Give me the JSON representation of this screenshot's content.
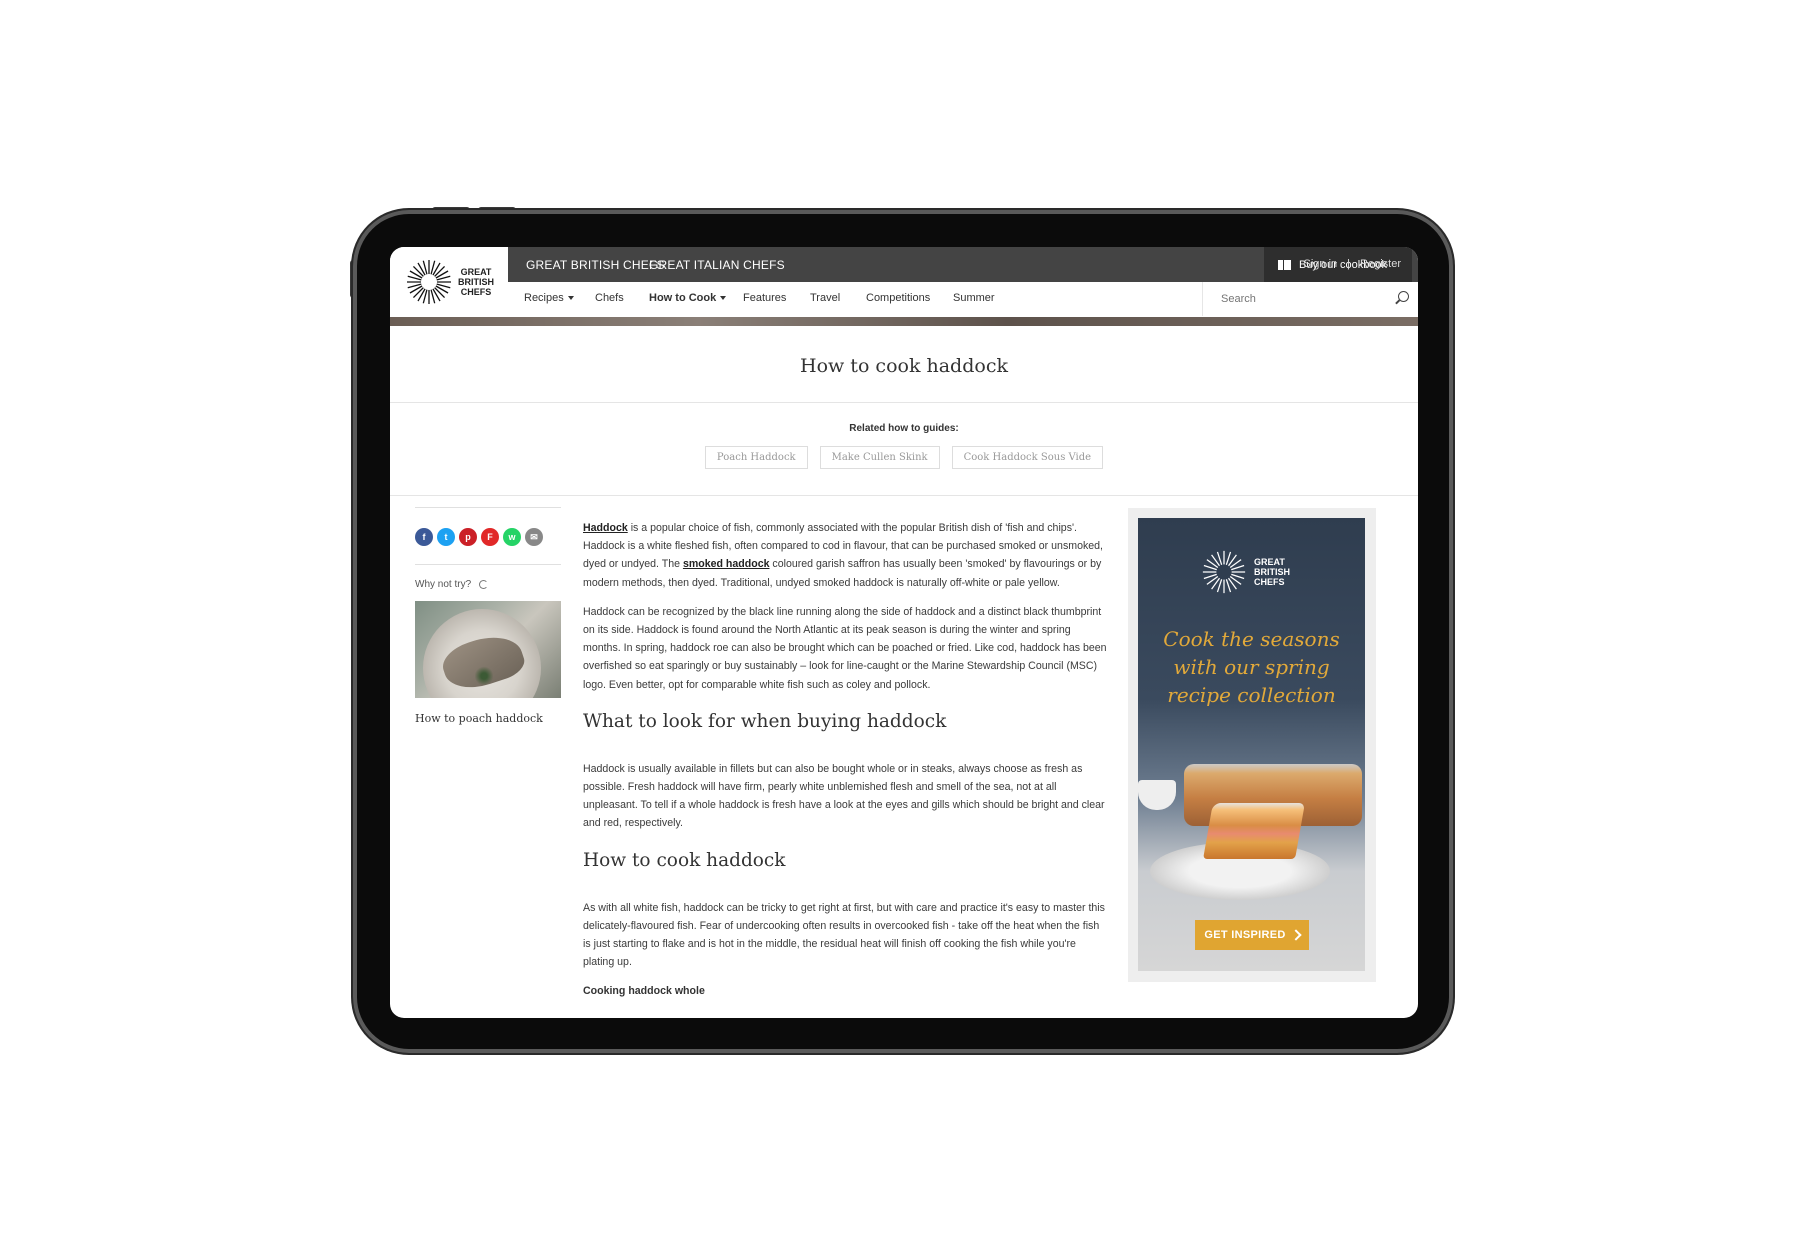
{
  "brand": {
    "logo_text": "GREAT\nBRITISH\nCHEFS",
    "sites": [
      "GREAT BRITISH CHEFS",
      "GREAT ITALIAN CHEFS"
    ]
  },
  "topbar": {
    "cookbook_label": "Buy our cookbook",
    "sign_in": "Sign in",
    "divider": "|",
    "register": "Register"
  },
  "nav": {
    "items": [
      {
        "label": "Recipes",
        "dropdown": true
      },
      {
        "label": "Chefs"
      },
      {
        "label": "How to Cook",
        "dropdown": true,
        "active": true
      },
      {
        "label": "Features"
      },
      {
        "label": "Travel"
      },
      {
        "label": "Competitions"
      },
      {
        "label": "Summer"
      }
    ],
    "search_placeholder": "Search"
  },
  "page": {
    "title": "How to cook haddock",
    "related_label": "Related how to guides:",
    "related": [
      "Poach Haddock",
      "Make Cullen Skink",
      "Cook Haddock Sous Vide"
    ]
  },
  "sidebar": {
    "share_icons": [
      {
        "name": "facebook-icon",
        "glyph": "f",
        "color": "#3b5998"
      },
      {
        "name": "twitter-icon",
        "glyph": "t",
        "color": "#1da1f2"
      },
      {
        "name": "pinterest-icon",
        "glyph": "p",
        "color": "#cb2027"
      },
      {
        "name": "flipboard-icon",
        "glyph": "F",
        "color": "#e12828"
      },
      {
        "name": "whatsapp-icon",
        "glyph": "w",
        "color": "#25d366"
      },
      {
        "name": "email-icon",
        "glyph": "✉",
        "color": "#888888"
      }
    ],
    "why_not_try": "Why not try?",
    "suggestion_caption": "How to poach haddock"
  },
  "article": {
    "p1_link1": "Haddock",
    "p1_text1": " is a popular choice of fish, commonly associated with the popular British dish of 'fish and chips'. Haddock is a white fleshed fish, often compared to cod in flavour, that can be purchased smoked or unsmoked, dyed or undyed. The ",
    "p1_link2": "smoked haddock",
    "p1_text2": " coloured garish saffron has usually been 'smoked' by flavourings or by modern methods, then dyed. Traditional, undyed smoked haddock is naturally off-white or pale yellow.",
    "p2": "Haddock can be recognized by the black line running along the side of haddock and a distinct black thumbprint on its side. Haddock is found around the North Atlantic at its peak season is during the winter and spring months. In spring, haddock roe can also be brought which can be poached or fried. Like cod, haddock has been overfished so eat sparingly or buy sustainably – look for line-caught or the Marine Stewardship Council (MSC) logo. Even better, opt for comparable white fish such as coley and pollock.",
    "h2_1": "What to look for when buying haddock",
    "p3": "Haddock is usually available in fillets but can also be bought whole or in steaks, always choose as fresh as possible. Fresh haddock will have firm, pearly white unblemished flesh and smell of the sea, not at all unpleasant. To tell if a whole haddock is fresh have a look at the eyes and gills which should be bright and clear and red, respectively.",
    "h2_2": "How to cook haddock",
    "p4": "As with all white fish, haddock can be tricky to get right at first, but with care and practice it's easy to master this delicately-flavoured fish. Fear of undercooking often results in overcooked fish - take off the heat when the fish is just starting to flake and is hot in the middle, the residual heat will finish off cooking the fish while you're plating up.",
    "subhead": "Cooking haddock whole"
  },
  "ad": {
    "logo_text": "GREAT\nBRITISH\nCHEFS",
    "headline": "Cook the seasons\nwith our spring\nrecipe collection",
    "cta": "GET INSPIRED",
    "headline_color": "#e2a93a",
    "cta_color": "#e0a531"
  }
}
